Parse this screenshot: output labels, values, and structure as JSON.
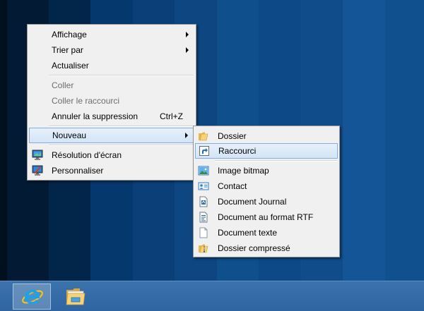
{
  "context_menu": {
    "items": [
      {
        "label": "Affichage"
      },
      {
        "label": "Trier par"
      },
      {
        "label": "Actualiser"
      },
      {
        "label": "Coller"
      },
      {
        "label": "Coller le raccourci"
      },
      {
        "label": "Annuler la suppression",
        "shortcut": "Ctrl+Z"
      },
      {
        "label": "Nouveau"
      },
      {
        "label": "Résolution d'écran"
      },
      {
        "label": "Personnaliser"
      }
    ]
  },
  "submenu_nouveau": {
    "items": [
      {
        "label": "Dossier"
      },
      {
        "label": "Raccourci"
      },
      {
        "label": "Image bitmap"
      },
      {
        "label": "Contact"
      },
      {
        "label": "Document Journal"
      },
      {
        "label": "Document au format RTF"
      },
      {
        "label": "Document texte"
      },
      {
        "label": "Dossier compressé"
      }
    ]
  },
  "taskbar": {
    "pinned": [
      "internet-explorer-icon",
      "file-explorer-icon"
    ]
  },
  "colors": {
    "menu_bg": "#f0f0f0",
    "highlight": "#d3e5f7",
    "highlight_border": "#84acdd",
    "taskbar": "#3269a5"
  }
}
